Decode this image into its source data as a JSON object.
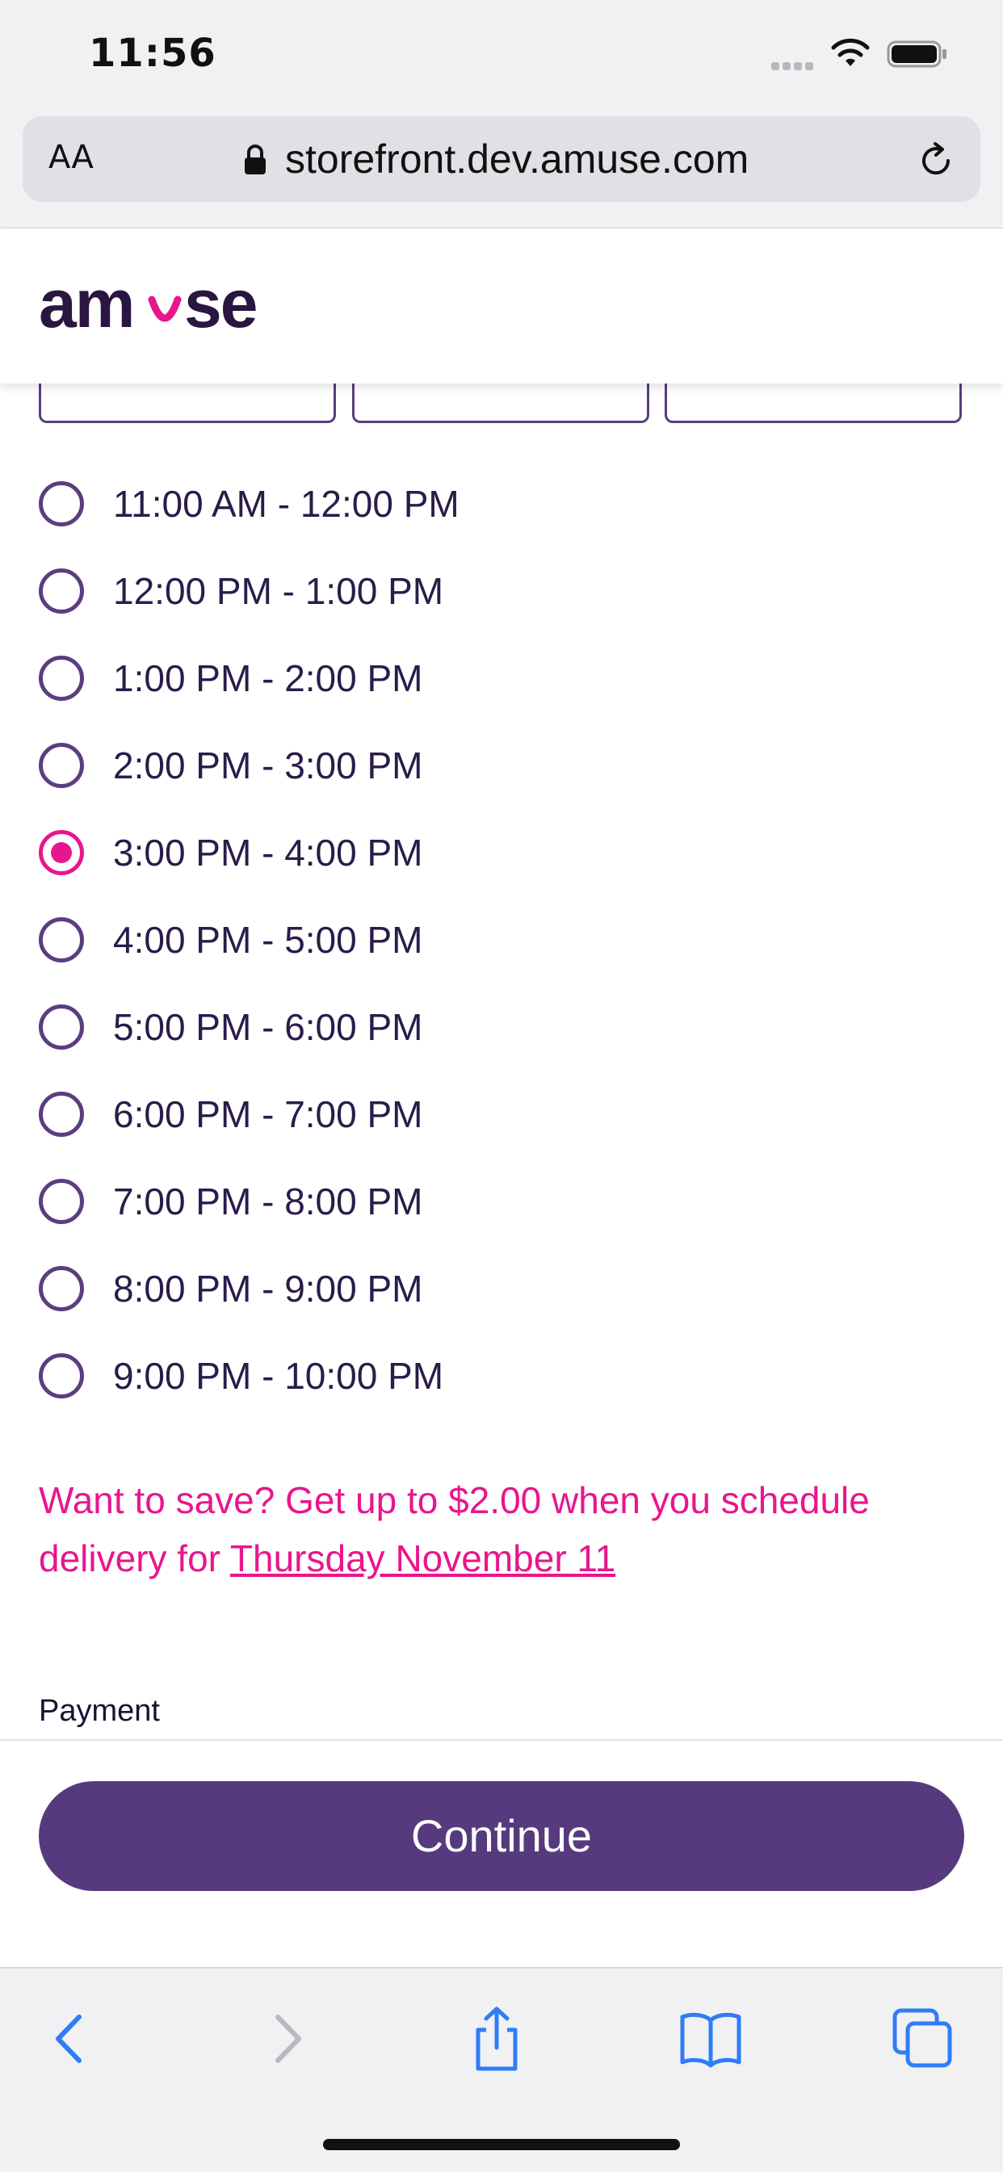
{
  "status_bar": {
    "time": "11:56"
  },
  "browser": {
    "text_size_button": "AA",
    "url": "storefront.dev.amuse.com"
  },
  "app": {
    "logo_text": "amuse"
  },
  "time_slots": [
    {
      "label": "11:00 AM - 12:00 PM",
      "selected": false
    },
    {
      "label": "12:00 PM - 1:00 PM",
      "selected": false
    },
    {
      "label": "1:00 PM - 2:00 PM",
      "selected": false
    },
    {
      "label": "2:00 PM - 3:00 PM",
      "selected": false
    },
    {
      "label": "3:00 PM - 4:00 PM",
      "selected": true
    },
    {
      "label": "4:00 PM - 5:00 PM",
      "selected": false
    },
    {
      "label": "5:00 PM - 6:00 PM",
      "selected": false
    },
    {
      "label": "6:00 PM - 7:00 PM",
      "selected": false
    },
    {
      "label": "7:00 PM - 8:00 PM",
      "selected": false
    },
    {
      "label": "8:00 PM - 9:00 PM",
      "selected": false
    },
    {
      "label": "9:00 PM - 10:00 PM",
      "selected": false
    }
  ],
  "promo": {
    "text": "Want to save? Get up to $2.00 when you schedule delivery for ",
    "link_text": "Thursday November 11"
  },
  "payment": {
    "section_label": "Payment"
  },
  "actions": {
    "continue_label": "Continue"
  },
  "colors": {
    "brand_purple": "#563a7d",
    "accent_pink": "#e8168c",
    "radio_border": "#5b3d80"
  }
}
